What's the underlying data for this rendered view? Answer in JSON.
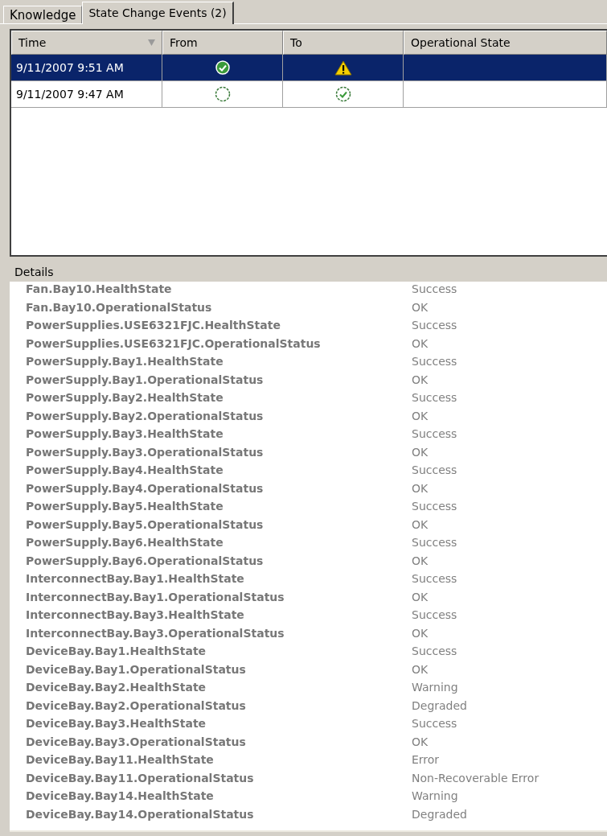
{
  "tabs": [
    {
      "label": "Knowledge",
      "selected": false
    },
    {
      "label": "State Change Events (2)",
      "selected": true
    }
  ],
  "events": {
    "columns": [
      "Time",
      "From",
      "To",
      "Operational State"
    ],
    "rows": [
      {
        "time": "9/11/2007 9:51 AM",
        "from": {
          "kind": "success"
        },
        "to": {
          "kind": "warning"
        },
        "selected": true
      },
      {
        "time": "9/11/2007 9:47 AM",
        "from": {
          "kind": "uninitialized"
        },
        "to": {
          "kind": "success-outline"
        },
        "selected": false
      }
    ]
  },
  "details": {
    "label": "Details",
    "properties": [
      {
        "name": "Fan.Bay10.HealthState",
        "value": "Success"
      },
      {
        "name": "Fan.Bay10.OperationalStatus",
        "value": "OK"
      },
      {
        "name": "PowerSupplies.USE6321FJC.HealthState",
        "value": "Success"
      },
      {
        "name": "PowerSupplies.USE6321FJC.OperationalStatus",
        "value": "OK"
      },
      {
        "name": "PowerSupply.Bay1.HealthState",
        "value": "Success"
      },
      {
        "name": "PowerSupply.Bay1.OperationalStatus",
        "value": "OK"
      },
      {
        "name": "PowerSupply.Bay2.HealthState",
        "value": "Success"
      },
      {
        "name": "PowerSupply.Bay2.OperationalStatus",
        "value": "OK"
      },
      {
        "name": "PowerSupply.Bay3.HealthState",
        "value": "Success"
      },
      {
        "name": "PowerSupply.Bay3.OperationalStatus",
        "value": "OK"
      },
      {
        "name": "PowerSupply.Bay4.HealthState",
        "value": "Success"
      },
      {
        "name": "PowerSupply.Bay4.OperationalStatus",
        "value": "OK"
      },
      {
        "name": "PowerSupply.Bay5.HealthState",
        "value": "Success"
      },
      {
        "name": "PowerSupply.Bay5.OperationalStatus",
        "value": "OK"
      },
      {
        "name": "PowerSupply.Bay6.HealthState",
        "value": "Success"
      },
      {
        "name": "PowerSupply.Bay6.OperationalStatus",
        "value": "OK"
      },
      {
        "name": "InterconnectBay.Bay1.HealthState",
        "value": "Success"
      },
      {
        "name": "InterconnectBay.Bay1.OperationalStatus",
        "value": "OK"
      },
      {
        "name": "InterconnectBay.Bay3.HealthState",
        "value": "Success"
      },
      {
        "name": "InterconnectBay.Bay3.OperationalStatus",
        "value": "OK"
      },
      {
        "name": "DeviceBay.Bay1.HealthState",
        "value": "Success"
      },
      {
        "name": "DeviceBay.Bay1.OperationalStatus",
        "value": "OK"
      },
      {
        "name": "DeviceBay.Bay2.HealthState",
        "value": "Warning"
      },
      {
        "name": "DeviceBay.Bay2.OperationalStatus",
        "value": "Degraded"
      },
      {
        "name": "DeviceBay.Bay3.HealthState",
        "value": "Success"
      },
      {
        "name": "DeviceBay.Bay3.OperationalStatus",
        "value": "OK"
      },
      {
        "name": "DeviceBay.Bay11.HealthState",
        "value": "Error"
      },
      {
        "name": "DeviceBay.Bay11.OperationalStatus",
        "value": "Non-Recoverable Error"
      },
      {
        "name": "DeviceBay.Bay14.HealthState",
        "value": "Warning"
      },
      {
        "name": "DeviceBay.Bay14.OperationalStatus",
        "value": "Degraded"
      }
    ]
  }
}
